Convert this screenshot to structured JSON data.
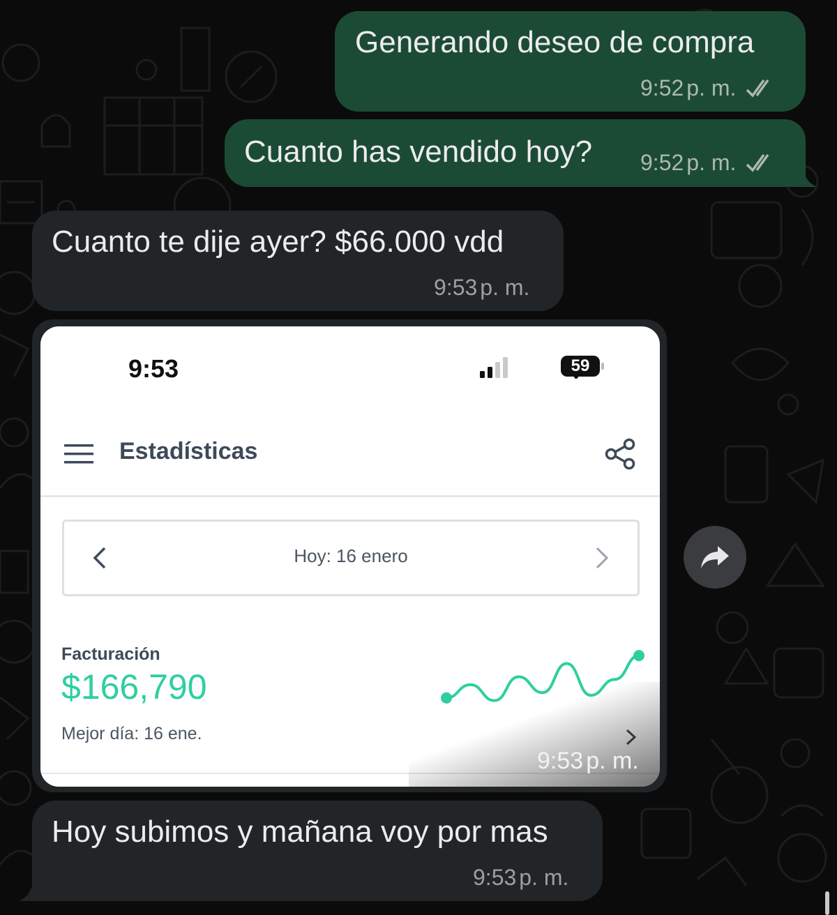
{
  "colors": {
    "outgoing_bubble": "#1c4b35",
    "incoming_bubble": "#222528",
    "metric_accent": "#2ecf9f",
    "read_ticks": "#aeb8b2"
  },
  "messages": [
    {
      "text": "Generando deseo de compra",
      "time": "9:52",
      "ampm": "p. m.",
      "status": "read-double-check-icon"
    },
    {
      "text": "Cuanto has vendido hoy?",
      "time": "9:52",
      "ampm": "p. m.",
      "status": "read-double-check-icon"
    },
    {
      "text": "Cuanto te dije ayer? $66.000 vdd",
      "time": "9:53",
      "ampm": "p. m."
    },
    {
      "text": "Hoy subimos y mañana voy por mas",
      "time": "9:53",
      "ampm": "p. m."
    }
  ],
  "image_message": {
    "time": "9:53",
    "ampm": "p. m.",
    "screenshot": {
      "status_bar": {
        "time": "9:53",
        "battery": "59"
      },
      "app_bar": {
        "title": "Estadísticas",
        "menu_icon": "hamburger-menu-icon",
        "share_icon": "share-icon"
      },
      "date_selector": {
        "label": "Hoy: 16 enero"
      },
      "metric": {
        "label": "Facturación",
        "value": "$166,790",
        "best_day": "Mejor día: 16 ene."
      },
      "sparkline": {
        "type": "line",
        "trend": [
          0.2,
          0.45,
          0.15,
          0.6,
          0.3,
          0.85,
          0.25,
          0.55,
          1.0
        ]
      }
    }
  },
  "forward_icon": "forward-arrow-icon"
}
